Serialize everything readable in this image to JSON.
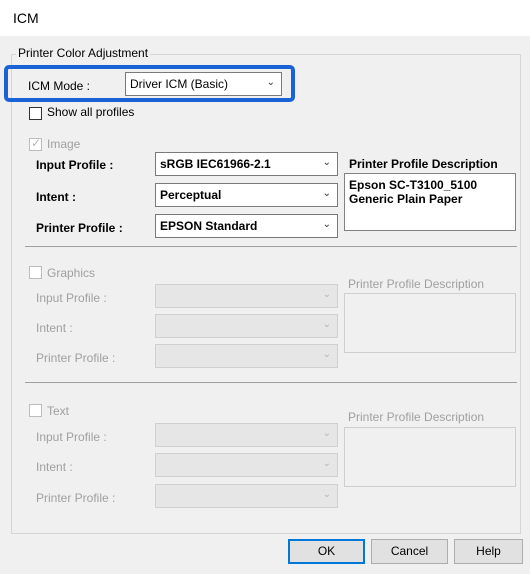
{
  "window": {
    "title": "ICM"
  },
  "printer_color_adjustment": {
    "group_title": "Printer Color Adjustment",
    "icm_mode": {
      "label": "ICM Mode :",
      "value": "Driver ICM (Basic)"
    },
    "show_all_profiles": {
      "label": "Show all profiles",
      "checked": false
    }
  },
  "image": {
    "label": "Image",
    "checked": true,
    "enabled": true,
    "input_profile": {
      "label": "Input Profile :",
      "value": "sRGB IEC61966-2.1"
    },
    "intent": {
      "label": "Intent :",
      "value": "Perceptual"
    },
    "printer_profile": {
      "label": "Printer Profile :",
      "value": "EPSON Standard"
    },
    "description_label": "Printer Profile Description",
    "description_text": "Epson SC-T3100_5100 Generic Plain Paper"
  },
  "graphics": {
    "label": "Graphics",
    "checked": false,
    "enabled": false,
    "input_profile": {
      "label": "Input Profile :",
      "value": ""
    },
    "intent": {
      "label": "Intent :",
      "value": ""
    },
    "printer_profile": {
      "label": "Printer Profile :",
      "value": ""
    },
    "description_label": "Printer Profile Description"
  },
  "text": {
    "label": "Text",
    "checked": false,
    "enabled": false,
    "input_profile": {
      "label": "Input Profile :",
      "value": ""
    },
    "intent": {
      "label": "Intent :",
      "value": ""
    },
    "printer_profile": {
      "label": "Printer Profile :",
      "value": ""
    },
    "description_label": "Printer Profile Description"
  },
  "buttons": {
    "ok": "OK",
    "cancel": "Cancel",
    "help": "Help"
  },
  "colors": {
    "highlight": "#1a63d6",
    "dialog_bg": "#f0f0f0",
    "disabled_text": "#a0a0a0"
  }
}
